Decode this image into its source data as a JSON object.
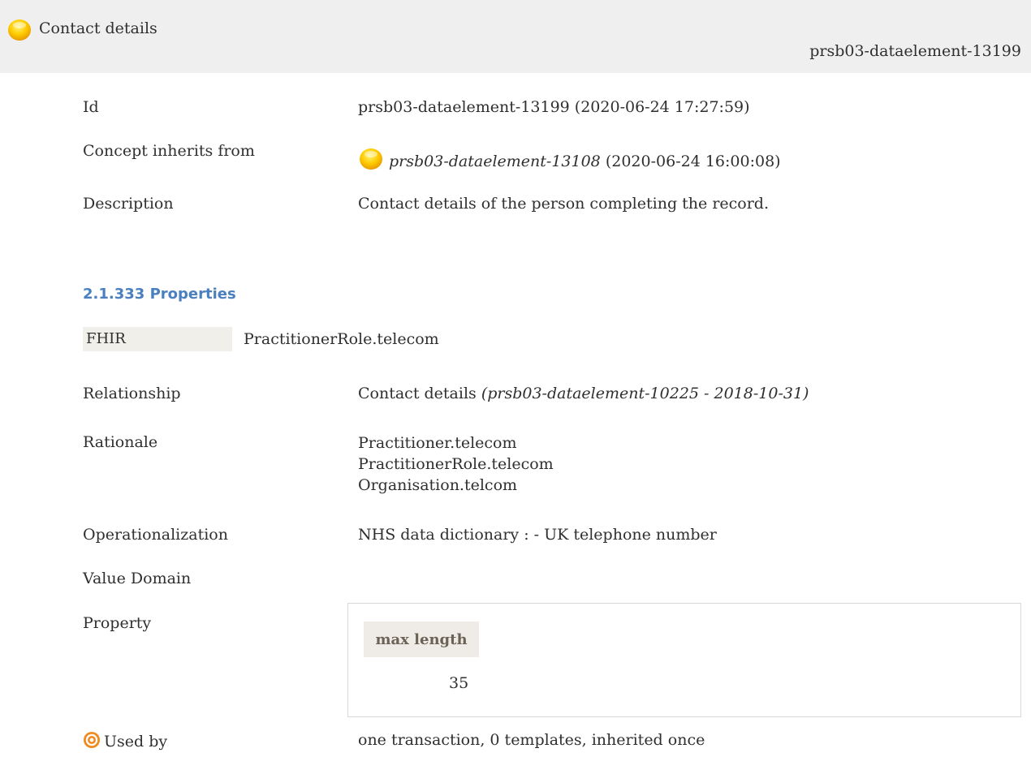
{
  "header": {
    "title": "Contact details",
    "identifier": "prsb03-dataelement-13199"
  },
  "details": {
    "id_label": "Id",
    "id_value": "prsb03-dataelement-13199 (2020-06-24 17:27:59)",
    "inherits_label": "Concept inherits from",
    "inherits_ref": "prsb03-dataelement-13108",
    "inherits_date": "(2020-06-24 16:00:08)",
    "description_label": "Description",
    "description_value": "Contact details of the person completing the record."
  },
  "properties": {
    "heading": "2.1.333 Properties",
    "fhir_label": "FHIR",
    "fhir_value": "PractitionerRole.telecom",
    "relationship_label": "Relationship",
    "relationship_value": "Contact details",
    "relationship_ref": "(prsb03-dataelement-10225 - 2018-10-31)",
    "rationale_label": "Rationale",
    "rationale_lines": [
      "Practitioner.telecom",
      "PractitionerRole.telecom",
      "Organisation.telcom"
    ],
    "operationalization_label": "Operationalization",
    "operationalization_value": "NHS data dictionary : - UK telephone number",
    "value_domain_label": "Value Domain",
    "property_label": "Property",
    "property_table": {
      "header": "max length",
      "value": "35"
    },
    "used_by_label": "Used by",
    "used_by_value": "one transaction, 0 templates, inherited once"
  },
  "colors": {
    "heading_blue": "#4a80c0",
    "header_band": "#efefef",
    "status_yellow": "#ffc400",
    "used_by_orange": "#f08a1c"
  },
  "icons": {
    "status": "yellow-status-circle-icon",
    "used_by": "target-icon"
  }
}
